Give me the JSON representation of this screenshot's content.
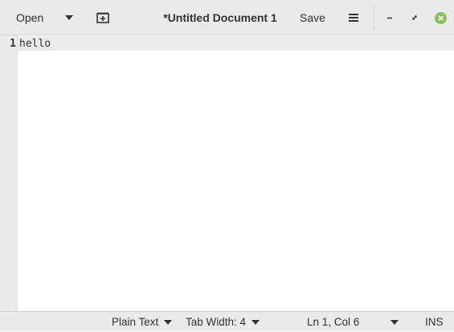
{
  "header": {
    "open_label": "Open",
    "title": "*Untitled Document 1",
    "save_label": "Save",
    "icons": {
      "open_dropdown": "chevron-down-icon",
      "new_tab": "new-tab-icon",
      "menu": "hamburger-menu-icon",
      "minimize": "minimize-icon",
      "maximize": "maximize-icon",
      "close": "close-icon"
    },
    "close_color": "#8abf5c"
  },
  "editor": {
    "lines": [
      {
        "number": "1",
        "text": "hello"
      }
    ]
  },
  "statusbar": {
    "language": "Plain Text",
    "tab_width": "Tab Width: 4",
    "cursor_position": "Ln 1, Col 6",
    "mode": "INS"
  }
}
